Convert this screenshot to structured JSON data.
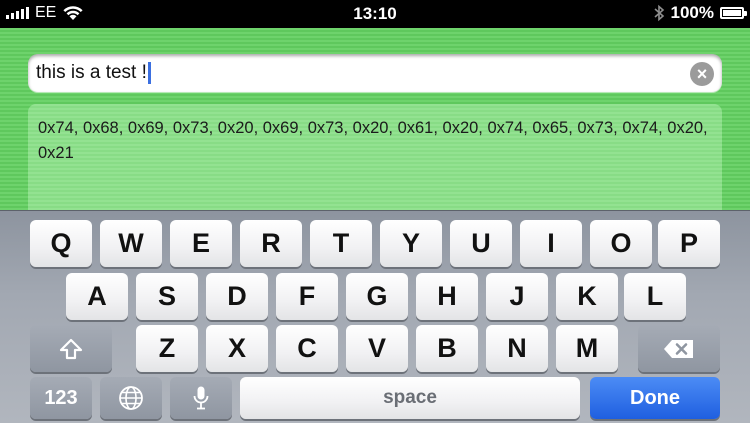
{
  "status_bar": {
    "carrier": "EE",
    "time": "13:10",
    "battery_percent": "100%"
  },
  "input": {
    "value": "this is a test !",
    "clear_icon": "clear-x-icon"
  },
  "output": {
    "text": "0x74, 0x68, 0x69, 0x73, 0x20, 0x69, 0x73, 0x20, 0x61, 0x20, 0x74, 0x65, 0x73, 0x74, 0x20, 0x21"
  },
  "keyboard": {
    "row1": [
      "Q",
      "W",
      "E",
      "R",
      "T",
      "Y",
      "U",
      "I",
      "O",
      "P"
    ],
    "row2": [
      "A",
      "S",
      "D",
      "F",
      "G",
      "H",
      "J",
      "K",
      "L"
    ],
    "row3": [
      "Z",
      "X",
      "C",
      "V",
      "B",
      "N",
      "M"
    ],
    "shift_icon": "shift-arrow-icon",
    "backspace_icon": "backspace-icon",
    "numbers_label": "123",
    "globe_icon": "globe-icon",
    "mic_icon": "microphone-icon",
    "space_label": "space",
    "done_label": "Done"
  },
  "colors": {
    "background_green": "#6ed36c",
    "done_blue": "#2a6be8"
  }
}
